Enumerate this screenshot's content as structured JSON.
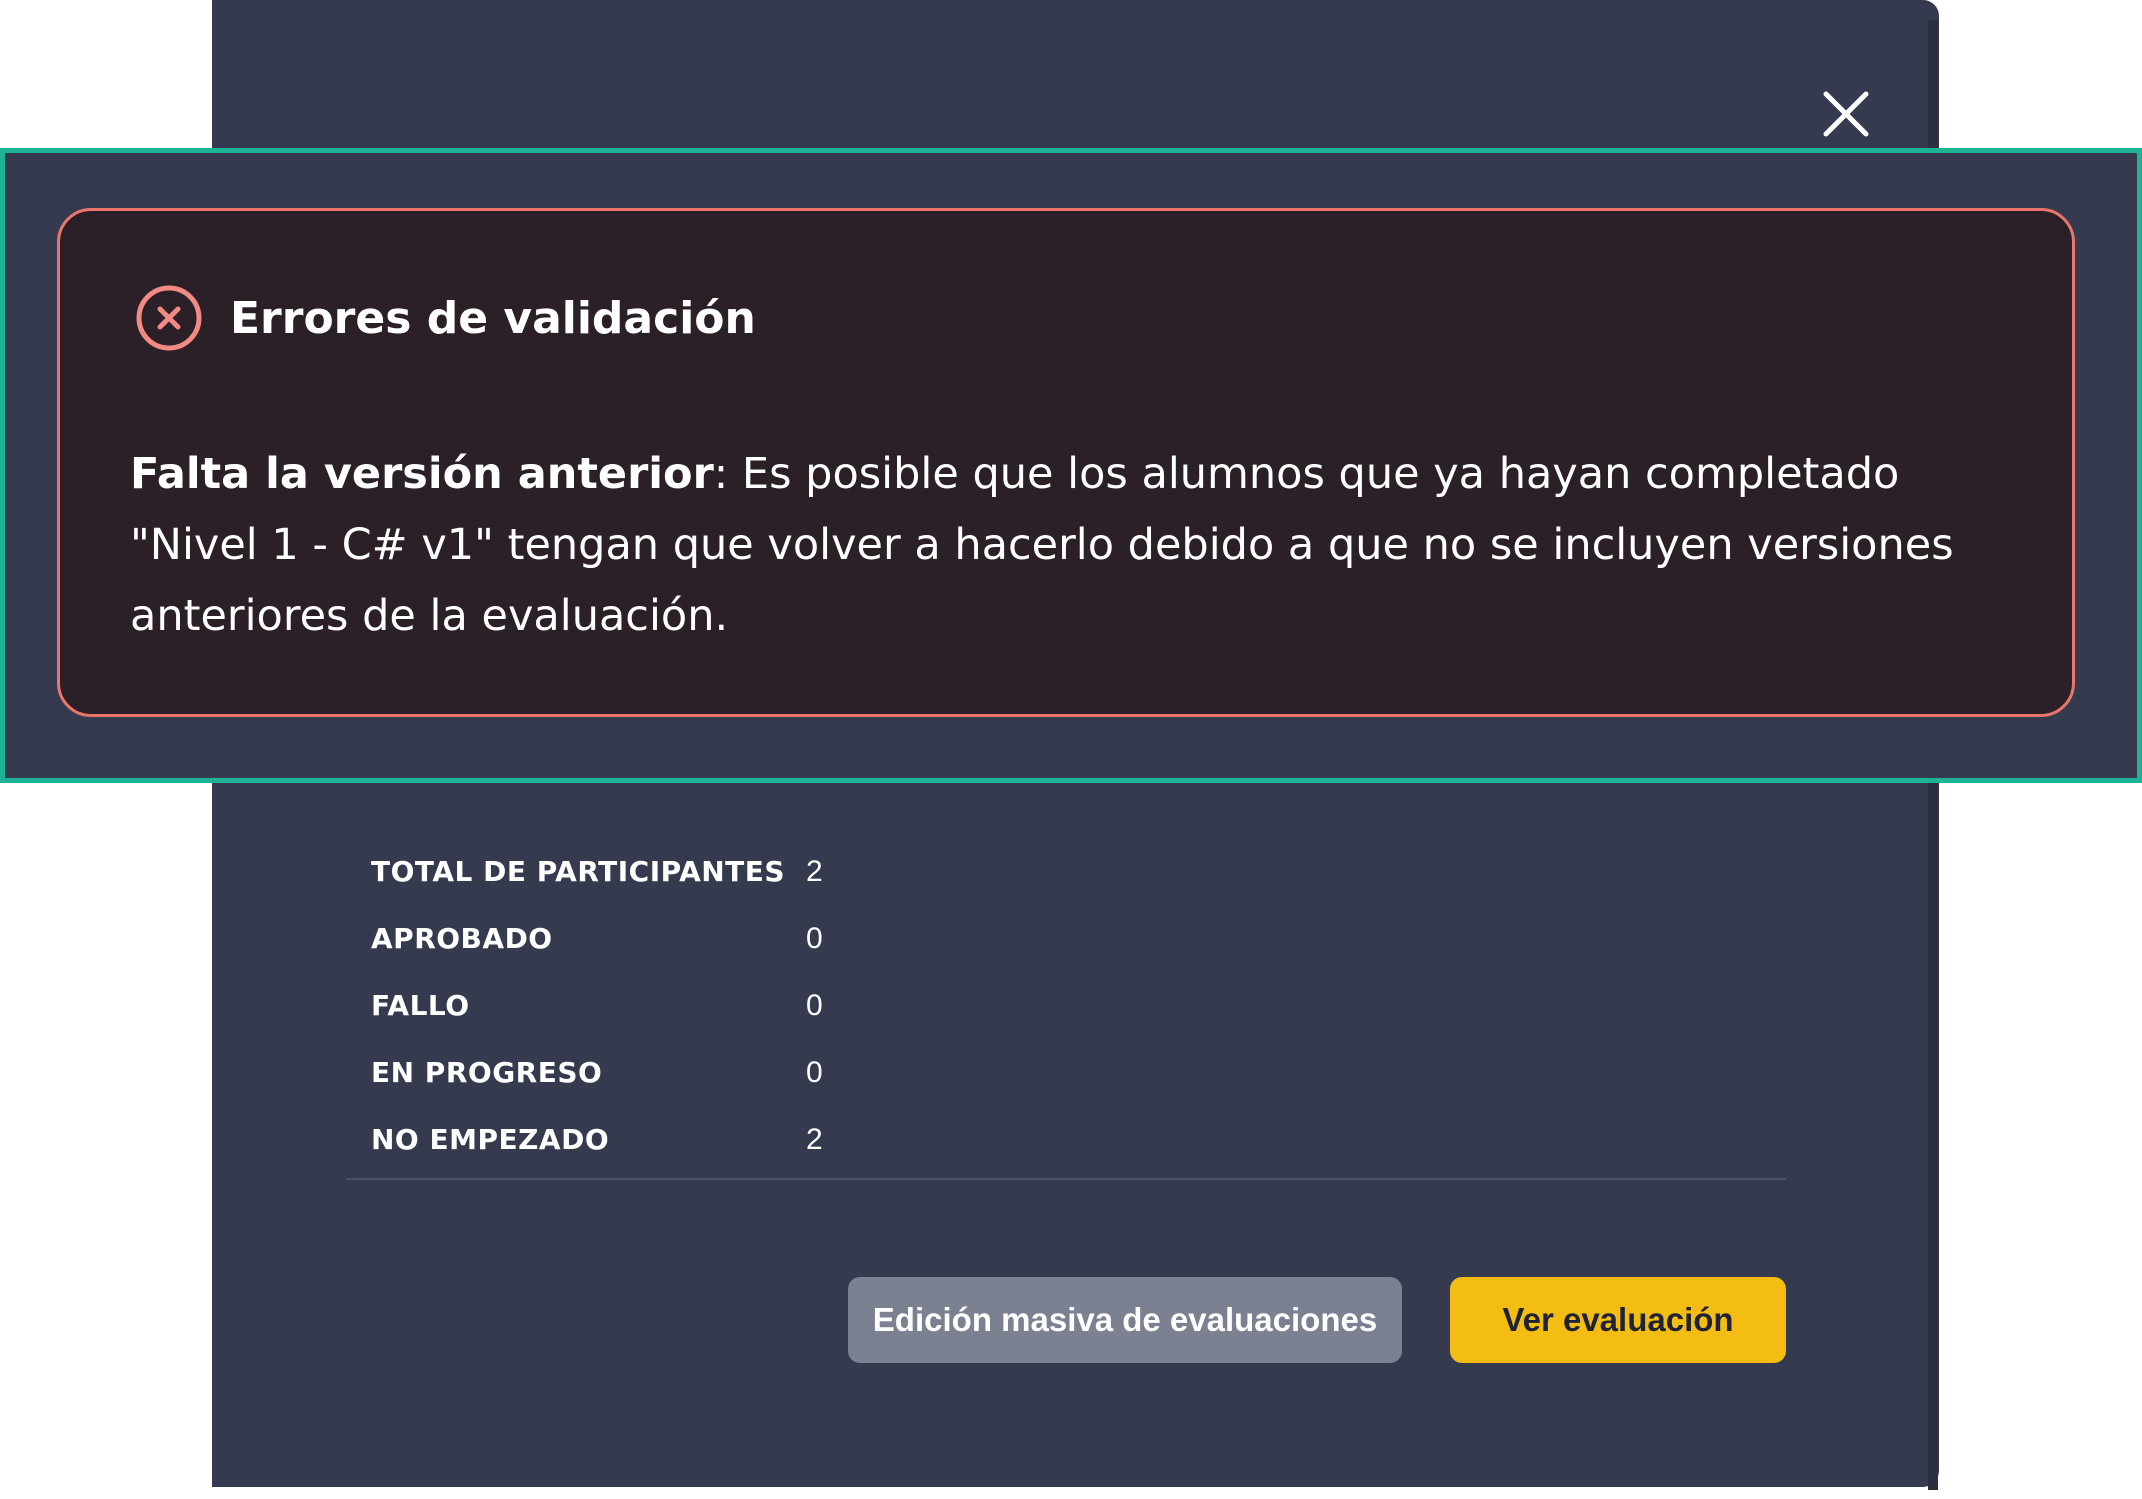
{
  "modal": {
    "close_icon": "close-icon"
  },
  "error": {
    "icon": "error-circle-x-icon",
    "title": "Errores de validación",
    "message_bold": "Falta la versión anterior",
    "message_rest": ": Es posible que los alumnos que ya hayan completado \"Nivel 1 - C# v1\" tengan que volver a hacerlo debido a que no se incluyen versiones anteriores de la evaluación."
  },
  "stats": [
    {
      "label": "TOTAL DE PARTICIPANTES",
      "value": "2"
    },
    {
      "label": "APROBADO",
      "value": "0"
    },
    {
      "label": "FALLO",
      "value": "0"
    },
    {
      "label": "EN PROGRESO",
      "value": "0"
    },
    {
      "label": "NO EMPEZADO",
      "value": "2"
    }
  ],
  "actions": {
    "bulk_edit_label": "Edición masiva de evaluaciones",
    "view_label": "Ver evaluación"
  },
  "colors": {
    "modal_bg": "#353a4f",
    "error_border": "#e8766b",
    "error_bg": "#2b1f28",
    "highlight_border": "#1db394",
    "primary_button": "#f4bd14",
    "secondary_button": "#7b8191"
  }
}
